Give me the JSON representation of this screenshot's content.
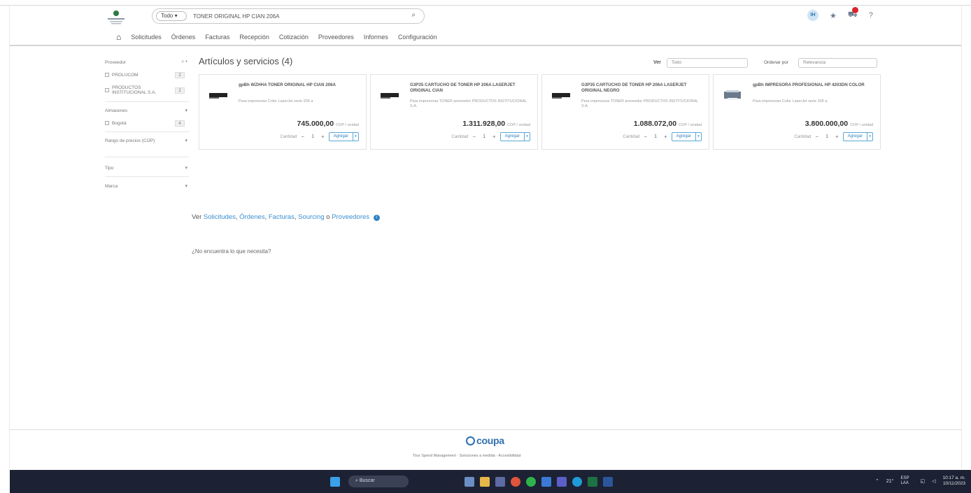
{
  "header": {
    "scope": "Todo ▾",
    "search_value": "TONER ORIGINAL HP CIAN 206A",
    "avatar": "IH",
    "nav": [
      "Solicitudes",
      "Órdenes",
      "Facturas",
      "Recepción",
      "Cotización",
      "Proveedores",
      "Informes",
      "Configuración"
    ]
  },
  "sidebar": {
    "sections": [
      {
        "label": "Proveedor",
        "icon": "⌕ ▾",
        "items": [
          {
            "label": "PROLUCOM",
            "count": "2"
          },
          {
            "label": "PRODUCTOS INSTITUCIONAL S.A.",
            "count": "2"
          }
        ]
      },
      {
        "label": "Almacenes",
        "chevron": "▾",
        "items": [
          {
            "label": "Bogotá",
            "count": "4"
          }
        ]
      },
      {
        "label": "Rango de precios (COP)",
        "chevron": "▾",
        "items": []
      },
      {
        "label": "Tipo",
        "chevron": "▾",
        "items": []
      },
      {
        "label": "Marca",
        "chevron": "▾",
        "items": []
      }
    ]
  },
  "main": {
    "title": "Artículos y servicios (4)",
    "ver_label": "Ver",
    "ver_value": "Todo",
    "sort_label": "Ordenar por",
    "sort_value": "Relevancia",
    "cards": [
      {
        "title": "gpBh WZHHA TONER ORIGINAL HP CIAN 206A",
        "desc": "Para impresoras Color LaserJet serie 206 a",
        "price": "745.000,00",
        "currency": "COP / unidad",
        "qty_label": "Cantidad",
        "qty": "1",
        "add": "Agregar"
      },
      {
        "title": "G3P35 CARTUCHO DE TONER HP 206A LASERJET ORIGINAL CIAN",
        "desc": "Para impresoras TONER proveedor PRODUCTOS INSTITUCIONAL S.A.",
        "price": "1.311.928,00",
        "currency": "COP / unidad",
        "qty_label": "Cantidad",
        "qty": "1",
        "add": "Agregar"
      },
      {
        "title": "G3P35 CARTUCHO DE TONER HP 206A LASERJET ORIGINAL NEGRO",
        "desc": "Para impresoras TONER proveedor PRODUCTOS INSTITUCIONAL S.A.",
        "price": "1.088.072,00",
        "currency": "COP / unidad",
        "qty_label": "Cantidad",
        "qty": "1",
        "add": "Agregar"
      },
      {
        "title": "gpBh IMPRESORA PROFESIONAL HP 4203DN COLOR",
        "desc": "Para impresoras Color LaserJet serie 206 a",
        "price": "3.800.000,00",
        "currency": "COP / unidad",
        "qty_label": "Cantidad",
        "qty": "1",
        "add": "Agregar"
      }
    ],
    "ver_prefix": "Ver",
    "links": [
      "Solicitudes",
      "Órdenes",
      "Facturas",
      "Sourcing",
      "Proveedores"
    ],
    "not_found": "¿No encuentra lo que necesita?"
  },
  "footer": {
    "logo_text": "coupa",
    "links": "Tour Spend Management · Soluciones a medida · Accesibilidad"
  },
  "taskbar": {
    "search": "Buscar",
    "weather": "21°",
    "lang": "ESP LAA",
    "time": "10:17 a. m.",
    "date": "10/11/2023"
  },
  "colors": {
    "accent": "#2f84c3",
    "taskbar": "#1c2233",
    "badge": "#d9232e"
  }
}
